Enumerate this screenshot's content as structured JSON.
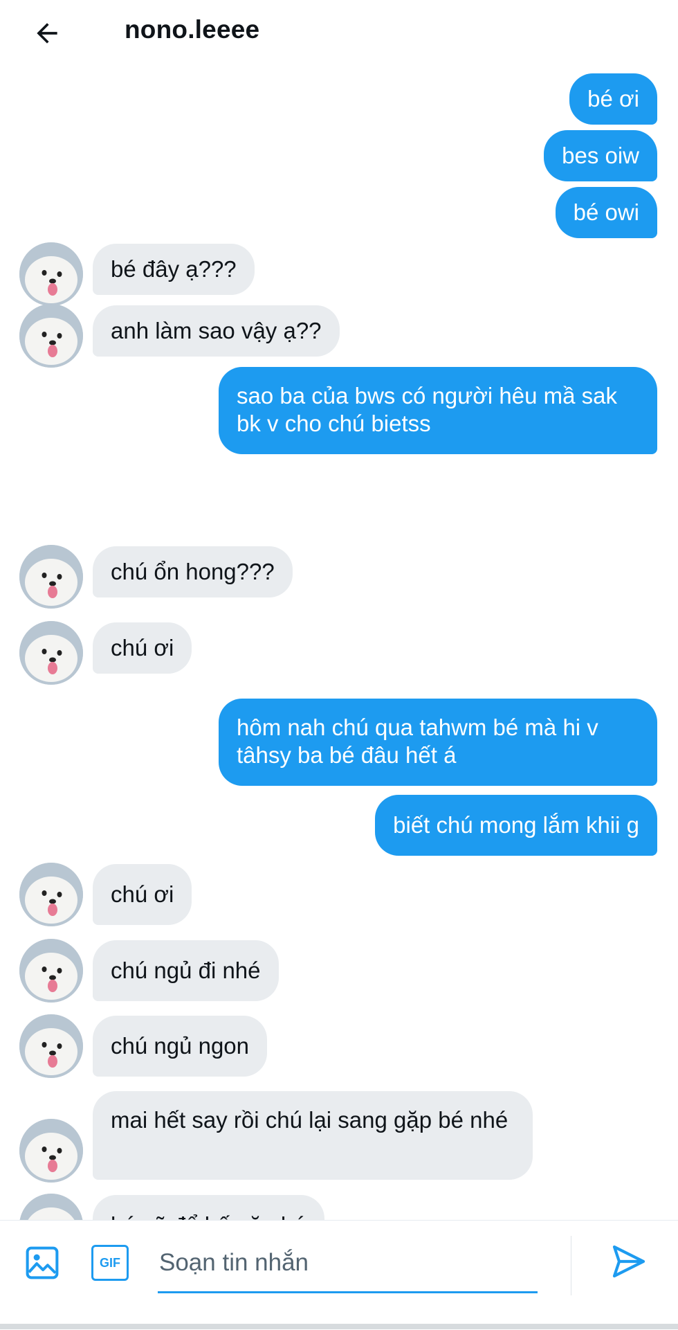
{
  "header": {
    "title": "nono.leeee",
    "back_icon": "arrow-left-icon"
  },
  "messages": [
    {
      "side": "sent",
      "text": "bé ơi"
    },
    {
      "side": "sent",
      "text": "bes oiw"
    },
    {
      "side": "sent",
      "text": "bé owi"
    },
    {
      "side": "received",
      "text": "bé đây ạ???"
    },
    {
      "side": "received",
      "text": "anh làm sao vậy ạ??"
    },
    {
      "side": "sent",
      "text": "sao ba của bws có người hêu mầ sak bk v cho chú bietss"
    },
    {
      "side": "received",
      "text": "chú ổn hong???"
    },
    {
      "side": "received",
      "text": "chú ơi"
    },
    {
      "side": "sent",
      "text": "hôm nah chú qua tahwm bé mà hi v tâhsy ba bé đâu hết á"
    },
    {
      "side": "sent",
      "text": "biết chú mong lắm khii g"
    },
    {
      "side": "received",
      "text": "chú ơi"
    },
    {
      "side": "received",
      "text": "chú ngủ đi nhé"
    },
    {
      "side": "received",
      "text": "chú ngủ ngon"
    },
    {
      "side": "received",
      "text": "mai hết say rồi chú lại sang gặp bé nhé"
    },
    {
      "side": "received",
      "text": "bé sẽ để bế gặp bé"
    }
  ],
  "composer": {
    "placeholder": "Soạn tin nhắn",
    "media_icon": "image-icon",
    "gif_label": "GIF",
    "send_icon": "send-icon"
  },
  "colors": {
    "accent": "#1d9bf0",
    "received_bubble": "#e9ecef",
    "text": "#0f1419"
  }
}
